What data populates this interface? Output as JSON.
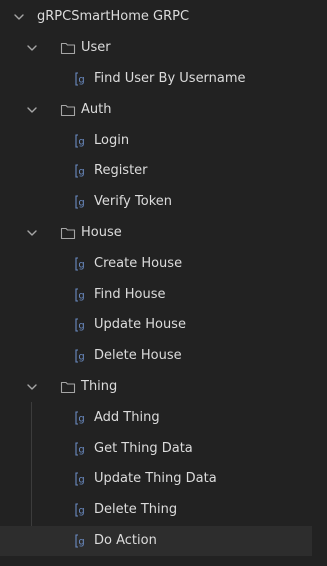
{
  "collection": {
    "name": "gRPCSmartHome GRPC",
    "expanded": true
  },
  "folders": [
    {
      "name": "User",
      "expanded": true,
      "methods": [
        "Find User By Username"
      ]
    },
    {
      "name": "Auth",
      "expanded": true,
      "methods": [
        "Login",
        "Register",
        "Verify Token"
      ]
    },
    {
      "name": "House",
      "expanded": true,
      "methods": [
        "Create House",
        "Find House",
        "Update House",
        "Delete House"
      ]
    },
    {
      "name": "Thing",
      "expanded": true,
      "methods": [
        "Add Thing",
        "Get Thing Data",
        "Update Thing Data",
        "Delete Thing",
        "Do Action"
      ]
    }
  ],
  "selected_method": "Do Action",
  "icons": {
    "expand": "chevron-down-icon",
    "folder": "folder-icon",
    "method": "grpc-method-icon"
  },
  "colors": {
    "background": "#222222",
    "selected_row": "#2d2d2d",
    "text": "#dcdcdc",
    "icon": "#a6a6a6",
    "grpc_icon": "#6b8cc4"
  }
}
